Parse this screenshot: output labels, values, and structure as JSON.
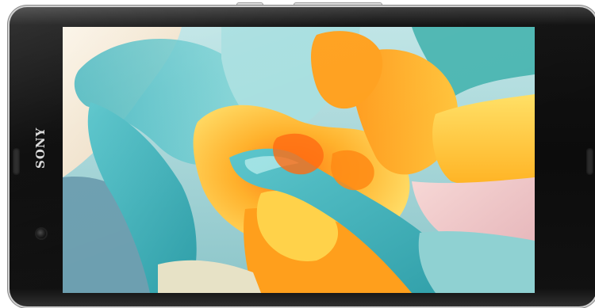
{
  "device": {
    "brand_text": "SONY",
    "frame_color": "#111111",
    "screen_subject": "flower-macro-photo"
  },
  "colors": {
    "petal_cyan": "#7fd4d8",
    "petal_orange": "#ff9a1f",
    "petal_yellow": "#ffd23a",
    "petal_cream": "#f6efe2",
    "petal_pink": "#f2c2c8"
  }
}
